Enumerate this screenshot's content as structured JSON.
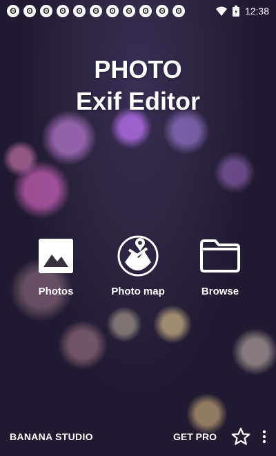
{
  "status_bar": {
    "notification_icons": [
      "ʘ",
      "ʘ",
      "ʘ",
      "ʘ",
      "ʘ",
      "ʘ",
      "ʘ",
      "ʘ",
      "ʘ",
      "ʘ",
      "ʘ"
    ],
    "time": "12:38"
  },
  "title": {
    "line1": "PHOTO",
    "line2": "Exif Editor"
  },
  "actions": {
    "photos": "Photos",
    "photo_map": "Photo map",
    "browse": "Browse"
  },
  "bottom_bar": {
    "brand": "BANANA STUDIO",
    "get_pro": "GET PRO"
  },
  "colors": {
    "accent": "#ffffff"
  }
}
